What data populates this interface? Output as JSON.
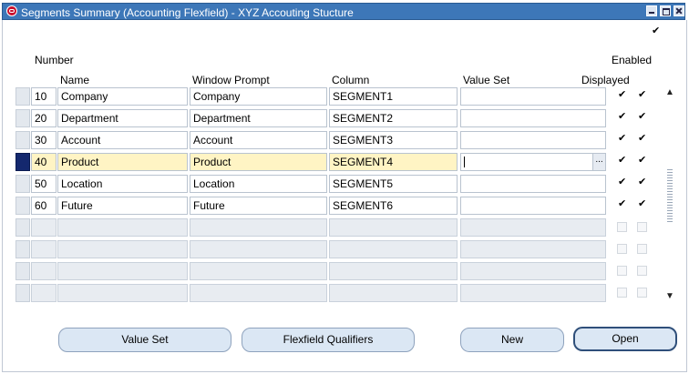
{
  "window": {
    "title": "Segments Summary (Accounting Flexfield) - XYZ Accouting Stucture"
  },
  "headers": {
    "number": "Number",
    "name": "Name",
    "window_prompt": "Window Prompt",
    "column": "Column",
    "value_set": "Value Set",
    "displayed": "Displayed",
    "enabled": "Enabled"
  },
  "rows": [
    {
      "number": "10",
      "name": "Company",
      "window_prompt": "Company",
      "column": "SEGMENT1",
      "value_set": "",
      "displayed": true,
      "enabled": true
    },
    {
      "number": "20",
      "name": "Department",
      "window_prompt": "Department",
      "column": "SEGMENT2",
      "value_set": "",
      "displayed": true,
      "enabled": true
    },
    {
      "number": "30",
      "name": "Account",
      "window_prompt": "Account",
      "column": "SEGMENT3",
      "value_set": "",
      "displayed": true,
      "enabled": true
    },
    {
      "number": "40",
      "name": "Product",
      "window_prompt": "Product",
      "column": "SEGMENT4",
      "value_set": "",
      "displayed": true,
      "enabled": true
    },
    {
      "number": "50",
      "name": "Location",
      "window_prompt": "Location",
      "column": "SEGMENT5",
      "value_set": "",
      "displayed": true,
      "enabled": true
    },
    {
      "number": "60",
      "name": "Future",
      "window_prompt": "Future",
      "column": "SEGMENT6",
      "value_set": "",
      "displayed": true,
      "enabled": true
    }
  ],
  "current_row_index": 3,
  "buttons": {
    "value_set": "Value Set",
    "flexfield_qualifiers": "Flexfield Qualifiers",
    "new": "New",
    "open": "Open"
  },
  "lov_button_label": "...",
  "colors": {
    "title_bar": "#3d77b8",
    "current_row": "#fff4c4",
    "active_selector": "#14286e"
  }
}
